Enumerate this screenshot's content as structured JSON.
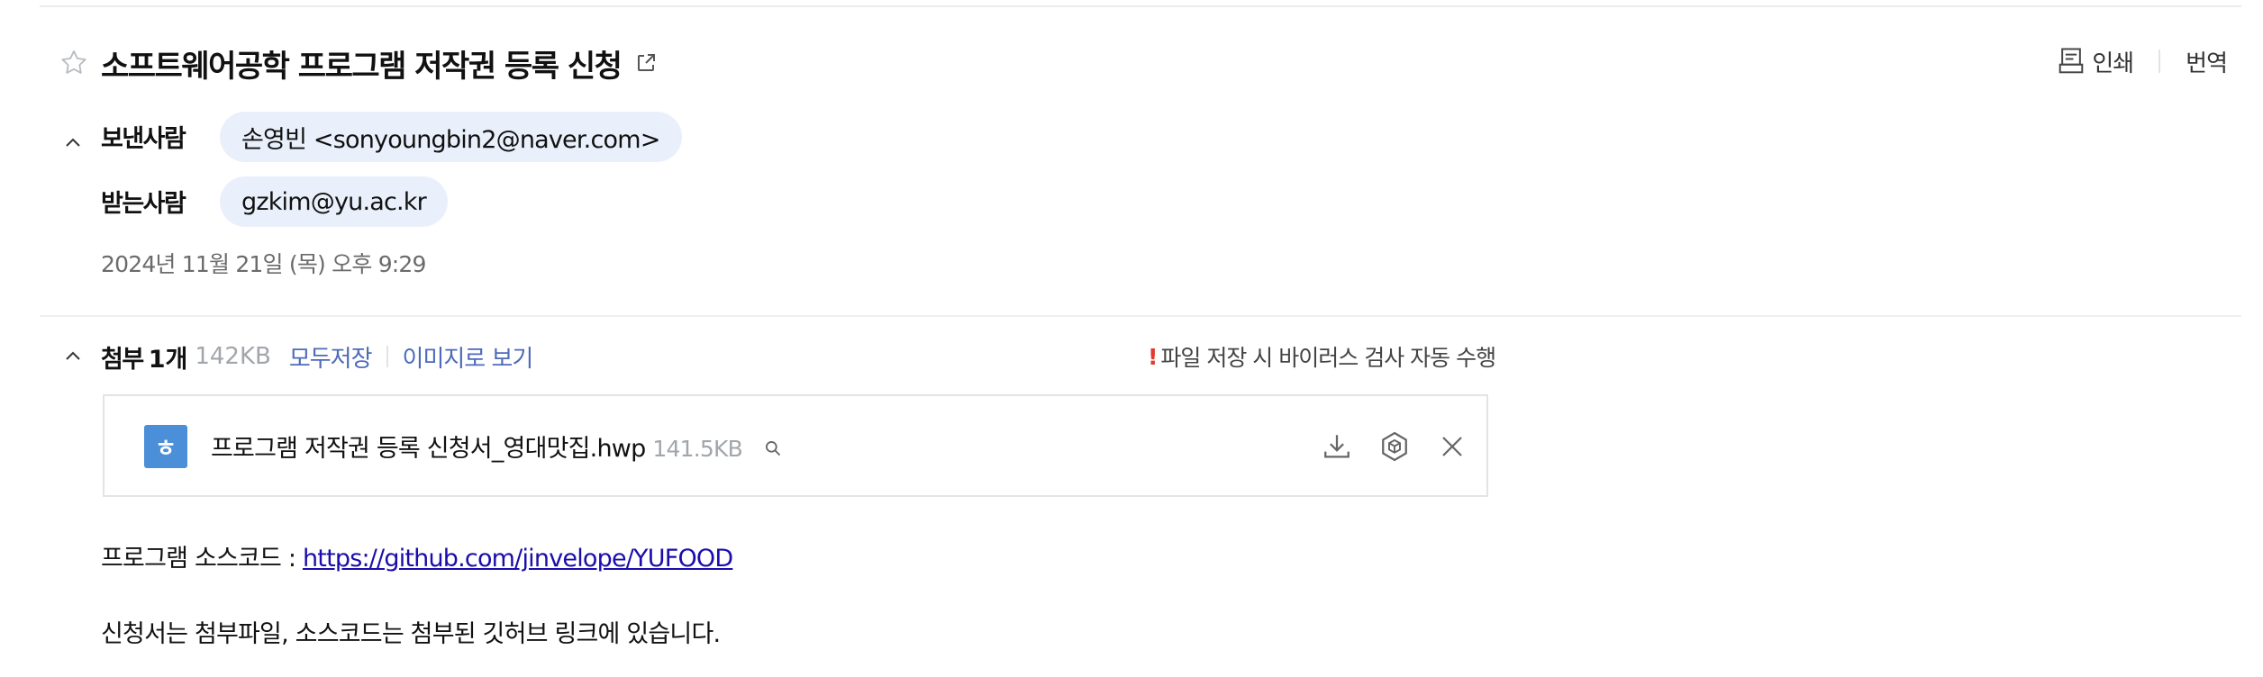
{
  "subject": "소프트웨어공학 프로그램 저작권 등록 신청",
  "actions": {
    "print": "인쇄",
    "translate": "번역"
  },
  "sender": {
    "label": "보낸사람",
    "value": "손영빈 <sonyoungbin2@naver.com>"
  },
  "recipient": {
    "label": "받는사람",
    "value": "gzkim@yu.ac.kr"
  },
  "date": "2024년 11월 21일 (목) 오후 9:29",
  "attachments": {
    "title": "첨부",
    "count": "1개",
    "total_size": "142KB",
    "save_all": "모두저장",
    "view_as_image": "이미지로 보기",
    "virus_notice": "파일 저장 시 바이러스 검사 자동 수행",
    "files": [
      {
        "icon_letter": "ㅎ",
        "name": "프로그램 저작권 등록 신청서_영대맛집.hwp",
        "size": "141.5KB"
      }
    ]
  },
  "body": {
    "source_label": "프로그램 소스코드 : ",
    "source_link": "https://github.com/jinvelope/YUFOOD",
    "note": "신청서는 첨부파일, 소스코드는 첨부된 깃허브 링크에 있습니다."
  },
  "icons": {
    "star": "star-outline-icon",
    "popout": "external-link-icon",
    "print": "printer-icon",
    "collapse": "chevron-up-icon",
    "download": "download-icon",
    "cloud": "hexagon-box-icon",
    "close": "close-icon",
    "search": "search-icon"
  },
  "colors": {
    "chip_bg": "#eaf0fb",
    "link": "#4d6bba",
    "warning": "#e23b2e",
    "file_icon": "#4a8fd8"
  }
}
